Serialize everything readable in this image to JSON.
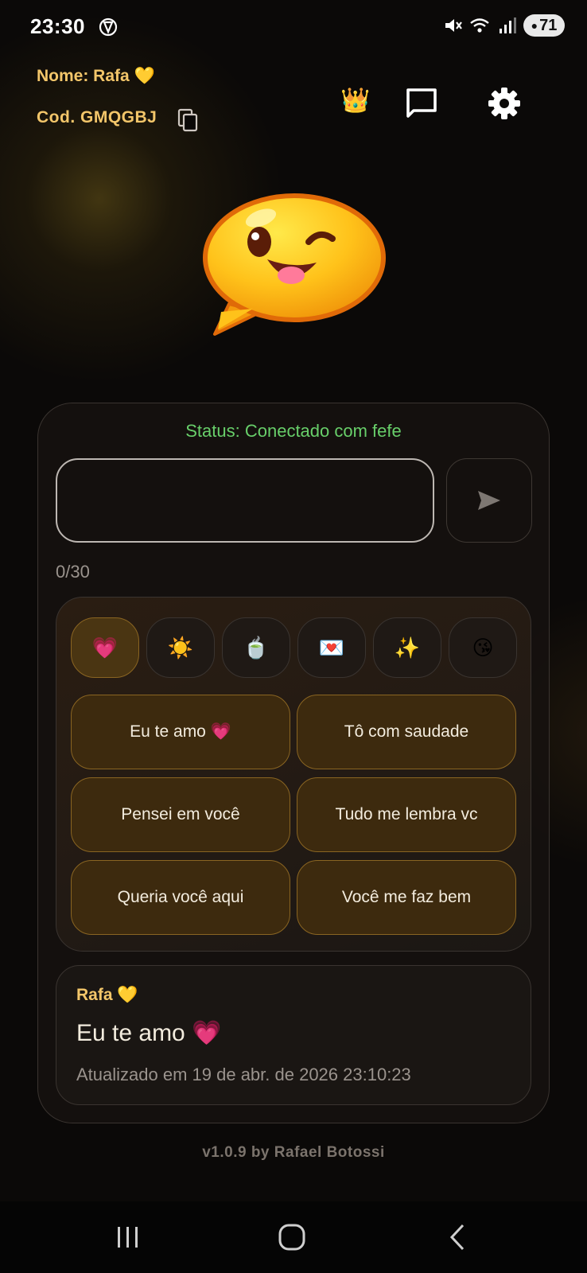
{
  "status_bar": {
    "time": "23:30",
    "battery": "71",
    "icons": [
      "openai-icon",
      "mute-icon",
      "wifi-icon",
      "signal-icon",
      "battery-icon"
    ]
  },
  "header": {
    "name_label": "Nome: Rafa 💛",
    "code_label": "Cod. GMQGBJ",
    "crown": "👑"
  },
  "connection": {
    "status": "Status: Conectado com fefe"
  },
  "composer": {
    "value": "",
    "placeholder": "",
    "counter": "0/30"
  },
  "categories": [
    {
      "emoji": "💗",
      "active": true
    },
    {
      "emoji": "☀️",
      "active": false
    },
    {
      "emoji": "🍵",
      "active": false
    },
    {
      "emoji": "💌",
      "active": false
    },
    {
      "emoji": "✨",
      "active": false
    },
    {
      "emoji": "😘",
      "active": false
    }
  ],
  "phrases": [
    "Eu te amo 💗",
    "Tô com saudade",
    "Pensei em você",
    "Tudo me lembra vc",
    "Queria você aqui",
    "Você me faz bem"
  ],
  "last_message": {
    "from": "Rafa 💛",
    "text": "Eu te amo 💗",
    "updated": "Atualizado em 19 de abr. de 2026 23:10:23"
  },
  "footer": {
    "version": "v1.0.9 by Rafael Botossi"
  },
  "colors": {
    "accent_gold": "#f3c66a",
    "status_green": "#68cf6a",
    "background": "#0b0908",
    "phrase_fill": "#3d2a0e",
    "phrase_border": "#8a6522"
  }
}
